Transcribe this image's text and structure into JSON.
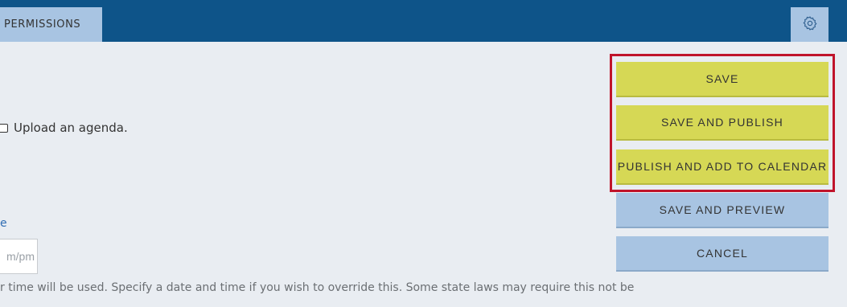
{
  "header": {
    "tab_label": "PERMISSIONS",
    "settings_icon": "gear-icon"
  },
  "form": {
    "agenda_label": "Upload an agenda.",
    "agenda_checked": false,
    "date_label_fragment": "e",
    "time_placeholder": "m/pm",
    "hint_text": "r time will be used. Specify a date and time if you wish to override this. Some state laws may require this not be"
  },
  "actions": {
    "save": "SAVE",
    "save_and_publish": "SAVE AND PUBLISH",
    "publish_and_add_to_calendar": "PUBLISH AND ADD TO CALENDAR",
    "save_and_preview": "SAVE AND PREVIEW",
    "cancel": "CANCEL"
  },
  "colors": {
    "topbar": "#0e5489",
    "tab": "#a8c4e2",
    "primary_button": "#d6d855",
    "secondary_button": "#a8c4e2",
    "highlight_border": "#c0142b",
    "link": "#2f6db3"
  }
}
